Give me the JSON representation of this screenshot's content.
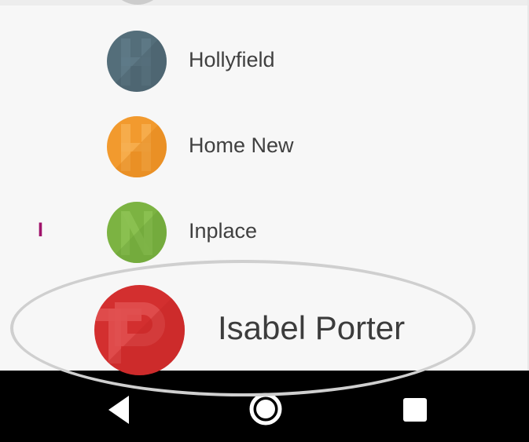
{
  "contacts": [
    {
      "name": "Hollyfield",
      "color": "#546e7a",
      "shade": "#455a64",
      "icon": "letter-h-avatar-icon"
    },
    {
      "name": "Home New",
      "color": "#f29a2e",
      "shade": "#e0861a",
      "icon": "letter-h-avatar-icon"
    },
    {
      "name": "Inplace",
      "color": "#7cb342",
      "shade": "#689f38",
      "icon": "letter-n-avatar-icon"
    }
  ],
  "index_letter": "I",
  "highlighted_contact": {
    "name": "Isabel Porter",
    "color": "#d32f2f",
    "shade": "#c62828",
    "icon": "letter-p-avatar-icon"
  },
  "colors": {
    "background": "#f7f7f7",
    "index_accent": "#a0136b",
    "nav_bar": "#000000",
    "name_text": "#404040"
  },
  "nav_bar": {
    "back": "back-triangle-icon",
    "home": "home-circle-icon",
    "recents": "recents-square-icon"
  }
}
